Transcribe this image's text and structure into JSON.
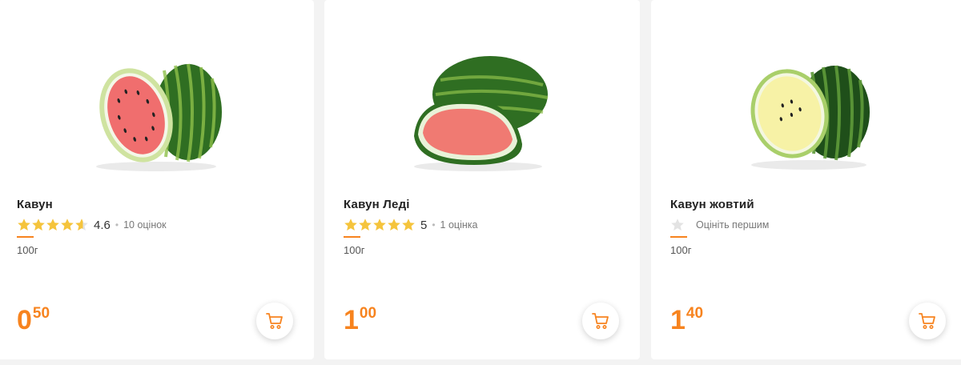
{
  "products": [
    {
      "name": "Кавун",
      "rating": 4.6,
      "rating_value": "4.6",
      "rating_count": "10 оцінок",
      "weight": "100г",
      "price_int": "0",
      "price_frac": "50",
      "image_icon": "red-watermelon-image",
      "cart_icon": "cart-icon"
    },
    {
      "name": "Кавун Леді",
      "rating": 5,
      "rating_value": "5",
      "rating_count": "1 оцінка",
      "weight": "100г",
      "price_int": "1",
      "price_frac": "00",
      "image_icon": "red-watermelon-image",
      "cart_icon": "cart-icon"
    },
    {
      "name": "Кавун жовтий",
      "rating": 0,
      "rate_first": "Оцініть першим",
      "weight": "100г",
      "price_int": "1",
      "price_frac": "40",
      "image_icon": "yellow-watermelon-image",
      "cart_icon": "cart-icon"
    }
  ],
  "colors": {
    "accent": "#f7831e",
    "star_filled": "#f5c43c",
    "star_empty": "#e3e3e3",
    "background": "#f3f3f3"
  }
}
